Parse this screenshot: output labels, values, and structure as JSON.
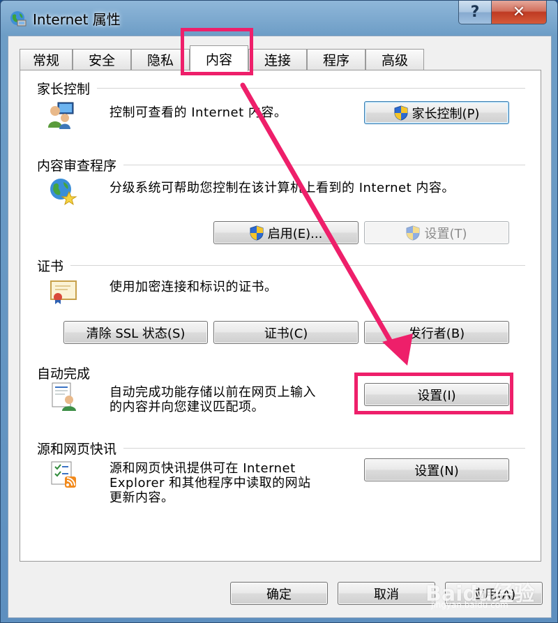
{
  "window": {
    "title": "Internet 属性",
    "help_label": "?",
    "close_label": "✕"
  },
  "tabs": [
    {
      "label": "常规"
    },
    {
      "label": "安全"
    },
    {
      "label": "隐私"
    },
    {
      "label": "内容"
    },
    {
      "label": "连接"
    },
    {
      "label": "程序"
    },
    {
      "label": "高级"
    }
  ],
  "parental": {
    "title": "家长控制",
    "desc": "控制可查看的 Internet 内容。",
    "button": "家长控制(P)"
  },
  "advisor": {
    "title": "内容审查程序",
    "desc": "分级系统可帮助您控制在该计算机上看到的 Internet 内容。",
    "enable_button": "启用(E)...",
    "settings_button": "设置(T)"
  },
  "certificates": {
    "title": "证书",
    "desc": "使用加密连接和标识的证书。",
    "clear_ssl_button": "清除 SSL 状态(S)",
    "cert_button": "证书(C)",
    "publisher_button": "发行者(B)"
  },
  "autocomplete": {
    "title": "自动完成",
    "desc_line1": "自动完成功能存储以前在网页上输入",
    "desc_line2": "的内容并向您建议匹配项。",
    "settings_button": "设置(I)"
  },
  "feeds": {
    "title": "源和网页快讯",
    "desc_line1": "源和网页快讯提供可在 Internet",
    "desc_line2": "Explorer 和其他程序中读取的网站",
    "desc_line3": "更新内容。",
    "settings_button": "设置(N)"
  },
  "footer": {
    "ok_button": "确定",
    "cancel_button": "取消",
    "apply_button": "应用(A)"
  },
  "watermark": {
    "brand": "Baidu经验",
    "url": "jingyan.baidu.com"
  },
  "colors": {
    "annotation": "#ee1f6a"
  }
}
